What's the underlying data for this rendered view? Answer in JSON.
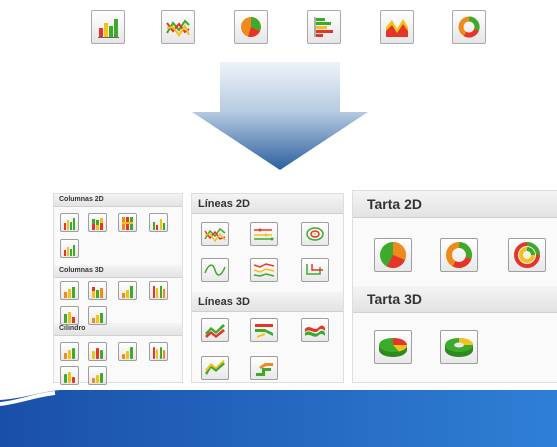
{
  "toolbar": {
    "icons": [
      "column-chart-icon",
      "line-chart-icon",
      "pie-chart-icon",
      "bar-chart-icon",
      "area-chart-icon",
      "donut-chart-icon"
    ]
  },
  "panel_columns": {
    "group1": "Columnas 2D",
    "group2": "Columnas 3D",
    "group3": "Cilindro"
  },
  "panel_lines": {
    "group1": "Líneas 2D",
    "group2": "Líneas 3D"
  },
  "panel_pie": {
    "group1": "Tarta 2D",
    "group2": "Tarta 3D"
  },
  "colors": {
    "red": "#e5352b",
    "green": "#3daa2b",
    "yellow": "#f2c21a",
    "orange": "#f08a1c",
    "blue": "#1d66c2"
  }
}
